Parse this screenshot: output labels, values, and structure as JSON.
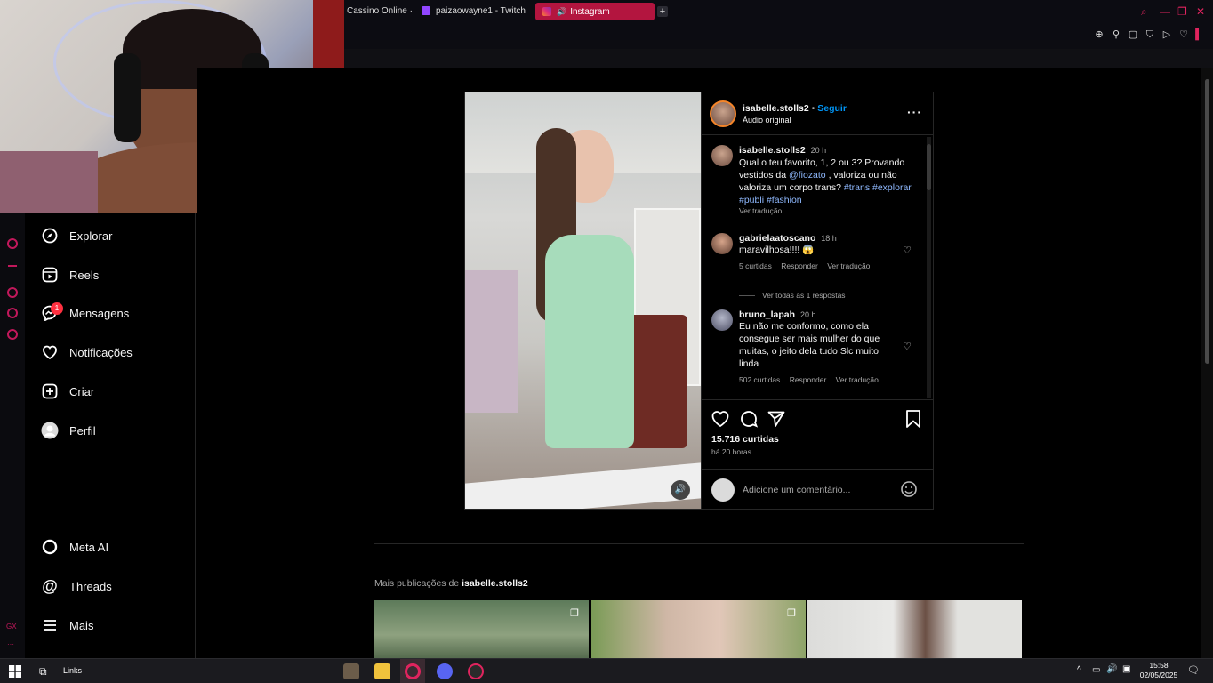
{
  "browser": {
    "tabs": [
      {
        "label": "Cassino Online ·",
        "icon": "cassino-tab-icon"
      },
      {
        "label": "paizaowayne1 - Twitch",
        "icon": "twitch-tab-icon"
      },
      {
        "label": "Instagram",
        "icon": "instagram-tab-icon",
        "active": true
      }
    ],
    "new_tab_label": "+",
    "accent_color": "#e0245e"
  },
  "sidebar": {
    "items": [
      {
        "label": "Explorar",
        "icon": "compass-icon"
      },
      {
        "label": "Reels",
        "icon": "reels-icon"
      },
      {
        "label": "Mensagens",
        "icon": "messenger-icon",
        "badge": "1"
      },
      {
        "label": "Notificações",
        "icon": "heart-icon"
      },
      {
        "label": "Criar",
        "icon": "plus-square-icon"
      },
      {
        "label": "Perfil",
        "icon": "profile-avatar-icon"
      }
    ],
    "bottom_items": [
      {
        "label": "Meta AI",
        "icon": "meta-ai-icon"
      },
      {
        "label": "Threads",
        "icon": "threads-icon"
      },
      {
        "label": "Mais",
        "icon": "menu-icon"
      }
    ]
  },
  "post": {
    "author": "isabelle.stolls2",
    "follow_label": "Seguir",
    "separator": "•",
    "audio": "Áudio original",
    "caption": {
      "username": "isabelle.stolls2",
      "time": "20 h",
      "text": "Qual o teu favorito, 1, 2 ou 3? Provando vestidos da",
      "mention": "@fiozato",
      "text2": ", valoriza ou não valoriza um corpo trans?",
      "hashtags": "#trans",
      "hashtags2": "#explorar #publi #fashion",
      "translate": "Ver tradução"
    },
    "comments": [
      {
        "username": "gabrielaatoscano",
        "time": "18 h",
        "text": "maravilhosa!!!! 😱",
        "likes": "5 curtidas",
        "reply": "Responder",
        "translate": "Ver tradução",
        "replies_link": "Ver todas as 1 respostas"
      },
      {
        "username": "bruno_lapah",
        "time": "20 h",
        "text": "Eu não me conformo, como ela consegue ser mais mulher do que muitas, o jeito dela tudo Slc muito linda",
        "likes": "502 curtidas",
        "reply": "Responder",
        "translate": "Ver tradução"
      }
    ],
    "likes_count": "15.716 curtidas",
    "posted_ago": "há 20 horas",
    "comment_placeholder": "Adicione um comentário..."
  },
  "more_posts": {
    "prefix": "Mais publicações de",
    "username": "isabelle.stolls2"
  },
  "taskbar": {
    "links_label": "Links",
    "time": "15:58",
    "date": "02/05/2025"
  }
}
